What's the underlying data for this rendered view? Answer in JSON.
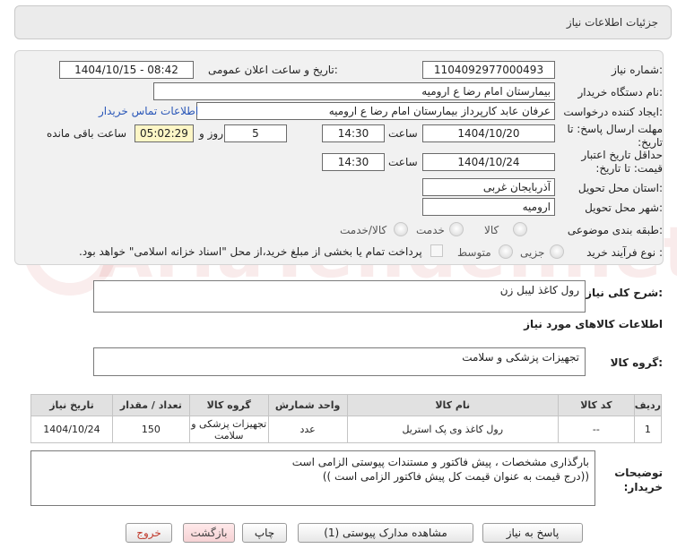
{
  "header": {
    "title": "جزئیات اطلاعات نیاز"
  },
  "fields": {
    "need_number_label": "شماره نیاز:",
    "need_number": "1104092977000493",
    "announce_label": "تاریخ و ساعت اعلان عمومی:",
    "announce_value": "1404/10/15 - 08:42",
    "buyer_label": "نام دستگاه خریدار:",
    "buyer_value": "بیمارستان امام رضا  ع  ارومیه",
    "creator_label": "ایجاد کننده درخواست:",
    "creator_value": "عرفان عابد کارپرداز بیمارستان امام رضا  ع  ارومیه",
    "contact_link": "اطلاعات تماس خریدار",
    "deadline_label": "مهلت ارسال پاسخ: تا تاریخ:",
    "deadline_date": "1404/10/20",
    "time_label": "ساعت",
    "deadline_time": "14:30",
    "days_value": "5",
    "days_label": "روز و",
    "remaining_time": "05:02:29",
    "remaining_label": "ساعت باقی مانده",
    "validity_label": "حداقل تاریخ اعتبار قیمت: تا تاریخ:",
    "validity_date": "1404/10/24",
    "validity_time": "14:30",
    "province_label": "استان محل تحویل:",
    "province_value": "آذربایجان غربی",
    "city_label": "شهر محل تحویل:",
    "city_value": "ارومیه",
    "category_label": "طبقه بندی موضوعی:",
    "category_options": [
      "کالا",
      "خدمت",
      "کالا/خدمت"
    ],
    "process_label": "نوع فرآیند خرید :",
    "process_options": [
      "جزیی",
      "متوسط"
    ],
    "payment_note": "پرداخت تمام یا بخشی از مبلغ خرید،از محل \"اسناد خزانه اسلامی\" خواهد بود."
  },
  "description": {
    "label": "شرح کلی نیاز:",
    "value": "رول کاغذ لیبل زن"
  },
  "goods_info_title": "اطلاعات کالاهای مورد نیاز",
  "goods_group": {
    "label": "گروه کالا:",
    "value": "تجهیزات پزشکی و سلامت"
  },
  "table": {
    "headers": [
      "ردیف",
      "کد کالا",
      "نام کالا",
      "واحد شمارش",
      "گروه کالا",
      "تعداد / مقدار",
      "تاریخ نیاز"
    ],
    "rows": [
      [
        "1",
        "--",
        "رول کاغذ وی پک استریل",
        "عدد",
        "تجهیزات پزشکی و سلامت",
        "150",
        "1404/10/24"
      ]
    ]
  },
  "buyer_notes": {
    "label": "توضیحات خریدار:",
    "line1": "بارگذاری مشخصات ، پیش فاکتور و مستندات پیوستی الزامی است",
    "line2": "((درج قیمت به عنوان قیمت کل پیش فاکتور الزامی است ))"
  },
  "buttons": {
    "reply": "پاسخ به نیاز",
    "attachments": "مشاهده مدارک پیوستی (1)",
    "print": "چاپ",
    "back": "بازگشت",
    "exit": "خروج"
  },
  "watermark": {
    "text": "AriaTender.net"
  }
}
